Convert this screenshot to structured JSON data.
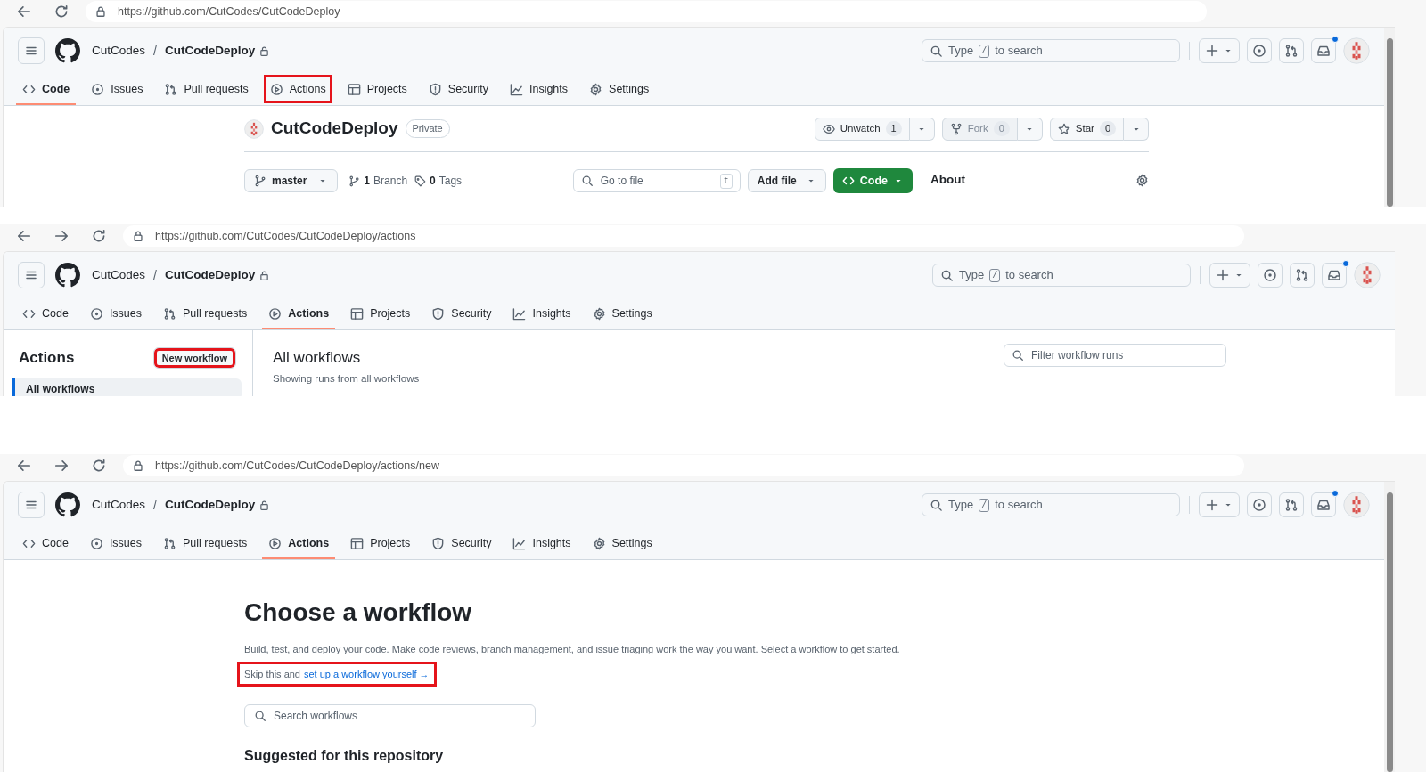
{
  "panels": [
    {
      "kind": "repo_code",
      "browser": {
        "url": "https://github.com/CutCodes/CutCodeDeploy",
        "forward_button": false
      },
      "scrollbar": true,
      "header": {
        "owner": "CutCodes",
        "separator": "/",
        "repo": "CutCodeDeploy",
        "search": {
          "before": "Type",
          "key": "/",
          "after": "to search"
        },
        "notifications": true
      },
      "tabs": [
        {
          "label": "Code",
          "selected": true,
          "highlighted": false
        },
        {
          "label": "Issues",
          "selected": false,
          "highlighted": false
        },
        {
          "label": "Pull requests",
          "selected": false,
          "highlighted": false
        },
        {
          "label": "Actions",
          "selected": false,
          "highlighted": true
        },
        {
          "label": "Projects",
          "selected": false,
          "highlighted": false
        },
        {
          "label": "Security",
          "selected": false,
          "highlighted": false
        },
        {
          "label": "Insights",
          "selected": false,
          "highlighted": false
        },
        {
          "label": "Settings",
          "selected": false,
          "highlighted": false
        }
      ],
      "repo": {
        "name": "CutCodeDeploy",
        "visibility": "Private",
        "actions": [
          {
            "label": "Unwatch",
            "count": "1",
            "disabled": false
          },
          {
            "label": "Fork",
            "count": "0",
            "disabled": true
          },
          {
            "label": "Star",
            "count": "0",
            "disabled": false
          }
        ],
        "branch": "master",
        "branches": {
          "count": "1",
          "label": "Branch"
        },
        "tags": {
          "count": "0",
          "label": "Tags"
        },
        "file_search": {
          "placeholder": "Go to file",
          "key": "t"
        },
        "add_file": "Add file",
        "code_button": "Code",
        "about": "About"
      }
    },
    {
      "kind": "actions",
      "browser": {
        "url": "https://github.com/CutCodes/CutCodeDeploy/actions",
        "forward_button": true
      },
      "scrollbar": false,
      "header": {
        "owner": "CutCodes",
        "separator": "/",
        "repo": "CutCodeDeploy",
        "search": {
          "before": "Type",
          "key": "/",
          "after": "to search"
        },
        "notifications": true
      },
      "tabs": [
        {
          "label": "Code",
          "selected": false,
          "highlighted": false
        },
        {
          "label": "Issues",
          "selected": false,
          "highlighted": false
        },
        {
          "label": "Pull requests",
          "selected": false,
          "highlighted": false
        },
        {
          "label": "Actions",
          "selected": true,
          "highlighted": false
        },
        {
          "label": "Projects",
          "selected": false,
          "highlighted": false
        },
        {
          "label": "Security",
          "selected": false,
          "highlighted": false
        },
        {
          "label": "Insights",
          "selected": false,
          "highlighted": false
        },
        {
          "label": "Settings",
          "selected": false,
          "highlighted": false
        }
      ],
      "sidebar": {
        "title": "Actions",
        "new_workflow": {
          "label": "New workflow",
          "highlighted": true
        },
        "items": [
          {
            "label": "All workflows",
            "selected": true
          }
        ]
      },
      "main": {
        "title": "All workflows",
        "subtitle": "Showing runs from all workflows",
        "filter": {
          "placeholder": "Filter workflow runs"
        }
      }
    },
    {
      "kind": "new_workflow",
      "browser": {
        "url": "https://github.com/CutCodes/CutCodeDeploy/actions/new",
        "forward_button": true
      },
      "scrollbar": true,
      "header": {
        "owner": "CutCodes",
        "separator": "/",
        "repo": "CutCodeDeploy",
        "search": {
          "before": "Type",
          "key": "/",
          "after": "to search"
        },
        "notifications": true
      },
      "tabs": [
        {
          "label": "Code",
          "selected": false,
          "highlighted": false
        },
        {
          "label": "Issues",
          "selected": false,
          "highlighted": false
        },
        {
          "label": "Pull requests",
          "selected": false,
          "highlighted": false
        },
        {
          "label": "Actions",
          "selected": true,
          "highlighted": false
        },
        {
          "label": "Projects",
          "selected": false,
          "highlighted": false
        },
        {
          "label": "Security",
          "selected": false,
          "highlighted": false
        },
        {
          "label": "Insights",
          "selected": false,
          "highlighted": false
        },
        {
          "label": "Settings",
          "selected": false,
          "highlighted": false
        }
      ],
      "content": {
        "title": "Choose a workflow",
        "description": "Build, test, and deploy your code. Make code reviews, branch management, and issue triaging work the way you want. Select a workflow to get started.",
        "skip": {
          "text": "Skip this and",
          "link": "set up a workflow yourself →",
          "highlighted": true
        },
        "search": {
          "placeholder": "Search workflows"
        },
        "section_title": "Suggested for this repository"
      }
    }
  ]
}
